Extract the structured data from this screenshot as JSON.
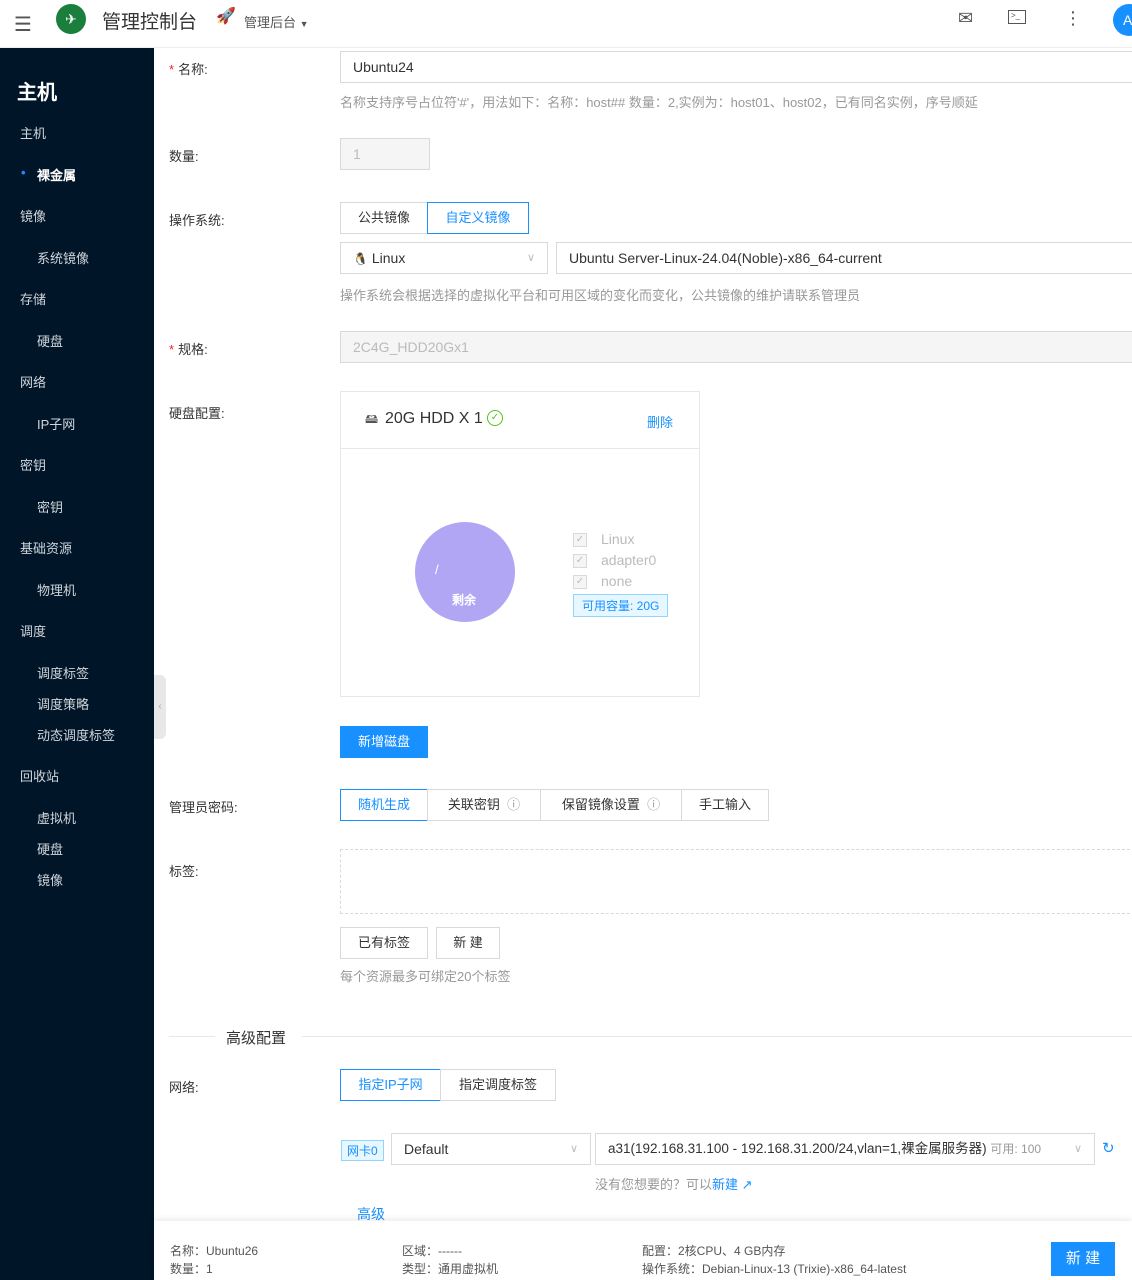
{
  "header": {
    "title": "管理控制台",
    "project": "管理后台",
    "avatar": "A"
  },
  "sidebar": {
    "title": "主机",
    "items": [
      {
        "label": "主机"
      },
      {
        "label": "裸金属",
        "active": true
      },
      {
        "label": "镜像"
      },
      {
        "label": "系统镜像"
      },
      {
        "label": "存储"
      },
      {
        "label": "硬盘"
      },
      {
        "label": "网络"
      },
      {
        "label": "IP子网"
      },
      {
        "label": "密钥"
      },
      {
        "label": "密钥"
      },
      {
        "label": "基础资源"
      },
      {
        "label": "物理机"
      },
      {
        "label": "调度"
      },
      {
        "label": "调度标签"
      },
      {
        "label": "调度策略"
      },
      {
        "label": "动态调度标签"
      },
      {
        "label": "回收站"
      },
      {
        "label": "虚拟机"
      },
      {
        "label": "硬盘"
      },
      {
        "label": "镜像"
      }
    ]
  },
  "form": {
    "name": {
      "label": "名称",
      "value": "Ubuntu24",
      "hint": "名称支持序号占位符'#'，用法如下：名称：host## 数量：2,实例为：host01、host02，已有同名实例，序号顺延"
    },
    "count": {
      "label": "数量",
      "value": "1"
    },
    "os": {
      "label": "操作系统",
      "tabs": [
        "公共镜像",
        "自定义镜像"
      ],
      "active_tab": 1,
      "os_type": "Linux",
      "image": "Ubuntu Server-Linux-24.04(Noble)-x86_64-current",
      "hint": "操作系统会根据选择的虚拟化平台和可用区域的变化而变化，公共镜像的维护请联系管理员"
    },
    "spec": {
      "label": "规格",
      "placeholder": "2C4G_HDD20Gx1"
    },
    "disk": {
      "label": "硬盘配置",
      "title": "20G HDD X 1",
      "delete": "删除",
      "pie_labels": [
        "/",
        "剩余"
      ],
      "pie_color": "#b0a6f4",
      "legend": [
        "Linux",
        "adapter0",
        "none"
      ],
      "capacity": "可用容量: 20G",
      "add": "新增磁盘"
    },
    "password": {
      "label": "管理员密码",
      "options": [
        "随机生成",
        "关联密钥",
        "保留镜像设置",
        "手工输入"
      ],
      "active": 0
    },
    "tags": {
      "label": "标签",
      "buttons": [
        "已有标签",
        "新 建"
      ],
      "hint": "每个资源最多可绑定20个标签"
    },
    "advanced": {
      "title": "高级配置"
    },
    "network": {
      "label": "网络",
      "tabs": [
        "指定IP子网",
        "指定调度标签"
      ],
      "active": 0,
      "nic": "网卡0",
      "vpc": "Default",
      "subnet": "a31(192.168.31.100 - 192.168.31.200/24,vlan=1,裸金属服务器)",
      "avail": "可用: 100",
      "missing": "没有您想要的？可以",
      "create": "新建",
      "advanced": "高级"
    }
  },
  "footer": {
    "name": "名称：Ubuntu26",
    "count": "数量：1",
    "region": "区域：------",
    "type": "类型：通用虚拟机",
    "config": "配置：2核CPU、4 GB内存",
    "os": "操作系统：Debian-Linux-13 (Trixie)-x86_64-latest",
    "submit": "新 建"
  },
  "colors": {
    "accent": "#1890ff",
    "sidebar": "#011528"
  }
}
